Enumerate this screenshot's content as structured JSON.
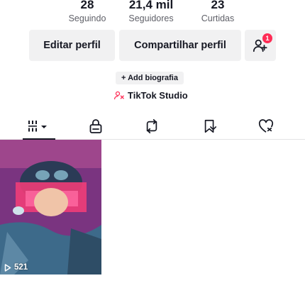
{
  "stats": {
    "following": {
      "value": "28",
      "label": "Seguindo"
    },
    "followers": {
      "value": "21,4 mil",
      "label": "Seguidores"
    },
    "likes": {
      "value": "23",
      "label": "Curtidas"
    }
  },
  "actions": {
    "edit_label": "Editar perfil",
    "share_label": "Compartilhar perfil",
    "add_friends_badge": "1"
  },
  "bio": {
    "add_bio_label": "+ Add biografia",
    "studio_label": "TikTok Studio"
  },
  "tabs": [
    {
      "icon": "grid-icon",
      "active": true
    },
    {
      "icon": "lock-icon"
    },
    {
      "icon": "repost-icon"
    },
    {
      "icon": "bookmark-icon"
    },
    {
      "icon": "heart-icon"
    }
  ],
  "videos": [
    {
      "views": "521"
    }
  ],
  "colors": {
    "accent": "#fe2c55",
    "text": "#161823",
    "button_bg": "#f1f1f2"
  }
}
